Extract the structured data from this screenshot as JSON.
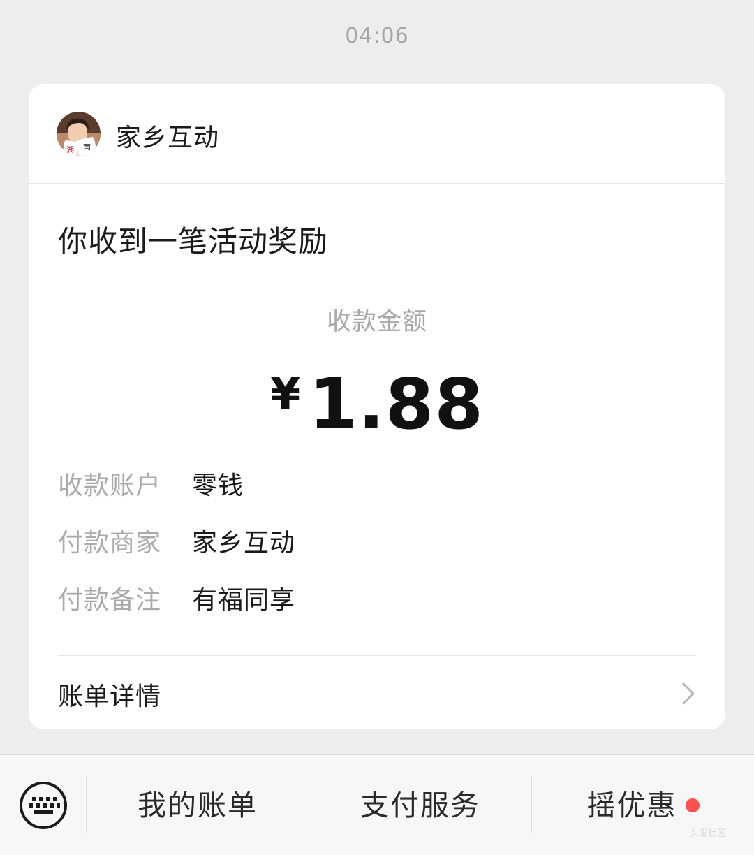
{
  "timestamp": "04:06",
  "card": {
    "merchant_name": "家乡互动",
    "avatar_badge_text": "湖南",
    "notice_title": "你收到一笔活动奖励",
    "amount_label": "收款金额",
    "amount_currency": "¥",
    "amount_value": "1.88",
    "details": [
      {
        "label": "收款账户",
        "value": "零钱"
      },
      {
        "label": "付款商家",
        "value": "家乡互动"
      },
      {
        "label": "付款备注",
        "value": "有福同享"
      }
    ],
    "bill_detail_label": "账单详情"
  },
  "bottom_menu": {
    "items": [
      {
        "label": "我的账单"
      },
      {
        "label": "支付服务"
      },
      {
        "label": "摇优惠",
        "badge": "red-dot"
      }
    ]
  },
  "watermark": "头发社区",
  "colors": {
    "background": "#ededed",
    "card": "#ffffff",
    "secondary_text": "#aaaaaa",
    "badge_red": "#fa5151"
  },
  "icons": {
    "keyboard": "keyboard-icon",
    "chevron": "chevron-right-icon"
  }
}
